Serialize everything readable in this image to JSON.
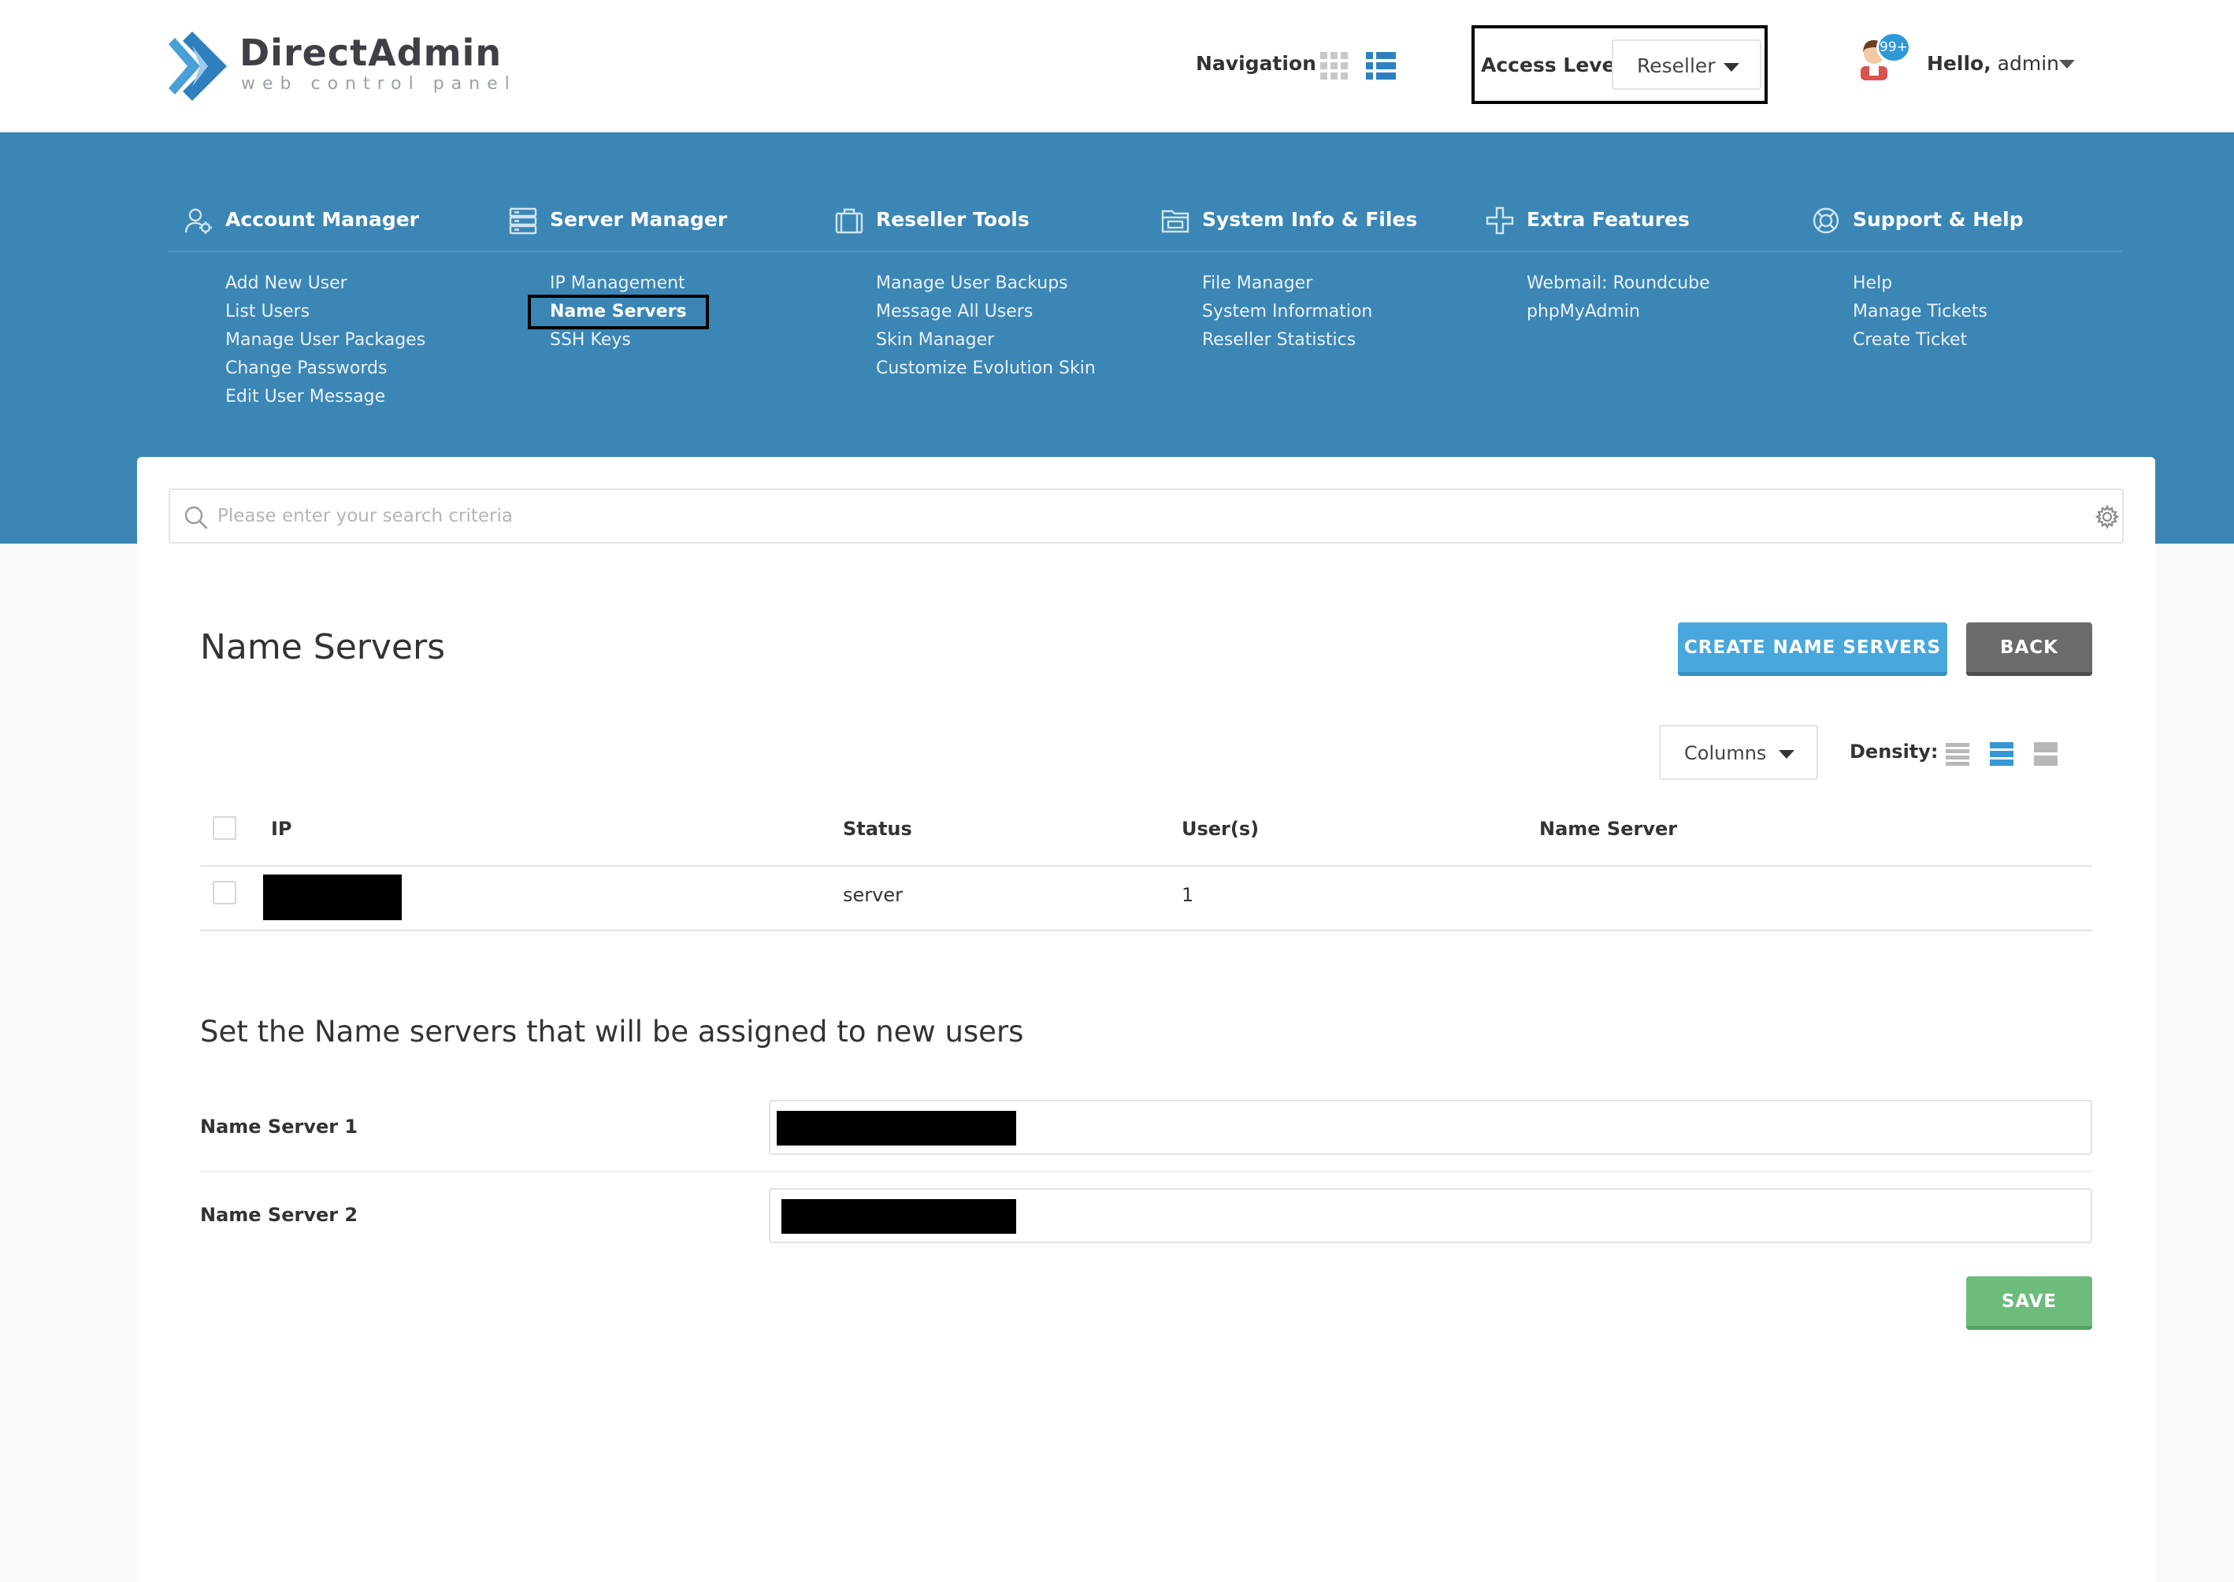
{
  "header": {
    "logo_title": "DirectAdmin",
    "logo_subtitle": "web control panel",
    "navigation_label": "Navigation",
    "access_level_label": "Access Level",
    "access_level_value": "Reseller",
    "notification_badge": "99+",
    "hello_prefix": "Hello,",
    "username": "admin"
  },
  "menu": {
    "sections": [
      {
        "title": "Account Manager",
        "icon": "account-manager-icon",
        "items": [
          "Add New User",
          "List Users",
          "Manage User Packages",
          "Change Passwords",
          "Edit User Message"
        ]
      },
      {
        "title": "Server Manager",
        "icon": "server-manager-icon",
        "items": [
          "IP Management",
          "Name Servers",
          "SSH Keys"
        ],
        "active_item": "Name Servers"
      },
      {
        "title": "Reseller Tools",
        "icon": "reseller-tools-icon",
        "items": [
          "Manage User Backups",
          "Message All Users",
          "Skin Manager",
          "Customize Evolution Skin"
        ]
      },
      {
        "title": "System Info & Files",
        "icon": "system-info-icon",
        "items": [
          "File Manager",
          "System Information",
          "Reseller Statistics"
        ]
      },
      {
        "title": "Extra Features",
        "icon": "extra-features-icon",
        "items": [
          "Webmail: Roundcube",
          "phpMyAdmin"
        ]
      },
      {
        "title": "Support & Help",
        "icon": "support-help-icon",
        "items": [
          "Help",
          "Manage Tickets",
          "Create Ticket"
        ]
      }
    ]
  },
  "search": {
    "placeholder": "Please enter your search criteria"
  },
  "page": {
    "title": "Name Servers",
    "create_button": "CREATE NAME SERVERS",
    "back_button": "BACK",
    "columns_button": "Columns",
    "density_label": "Density:"
  },
  "table": {
    "headers": [
      "IP",
      "Status",
      "User(s)",
      "Name Server"
    ],
    "rows": [
      {
        "ip": "[redacted]",
        "status": "server",
        "users": "1",
        "name_server": ""
      }
    ]
  },
  "assign_form": {
    "title": "Set the Name servers that will be assigned to new users",
    "fields": [
      {
        "label": "Name Server 1",
        "value": "[redacted]"
      },
      {
        "label": "Name Server 2",
        "value": "[redacted]"
      }
    ],
    "save_button": "SAVE"
  },
  "colors": {
    "band_blue": "#3b86b5",
    "accent_blue": "#48a8de",
    "back_gray": "#6b6b6b",
    "save_green": "#6cbc7c"
  }
}
